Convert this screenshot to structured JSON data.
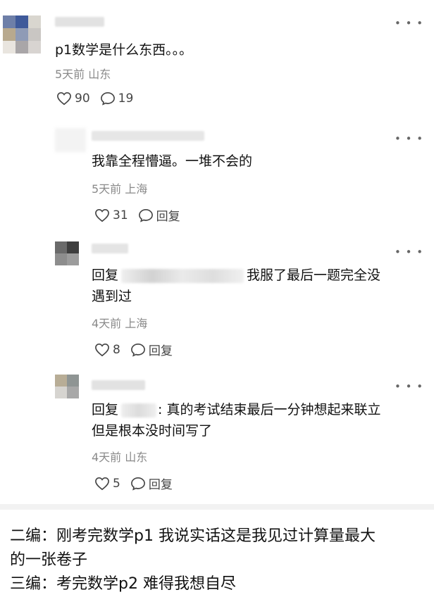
{
  "comments": [
    {
      "text": "p1数学是什么东西。。。",
      "meta": "5天前 山东",
      "likes": "90",
      "replies": "19"
    },
    {
      "text": "我靠全程懵逼。一堆不会的",
      "meta": "5天前 上海",
      "likes": "31",
      "reply_label": "回复"
    },
    {
      "reply_prefix": "回复",
      "text_line1": "我服了最后一题完全没",
      "text_line2": "遇到过",
      "meta": "4天前 上海",
      "likes": "8",
      "reply_label": "回复"
    },
    {
      "reply_prefix": "回复",
      "text_line1": ": 真的考试结束最后一分钟想起来联立",
      "text_line2": "但是根本没时间写了",
      "meta": "4天前 山东",
      "likes": "5",
      "reply_label": "回复"
    }
  ],
  "edits": {
    "line1": "二编：刚考完数学p1 我说实话这是我见过计算量最大",
    "line2": "的一张卷子",
    "line3": "三编：考完数学p2 难得我想自尽"
  },
  "icons": {
    "like": "heart-outline-icon",
    "comment": "speech-bubble-icon",
    "more": "more-dots-icon"
  }
}
